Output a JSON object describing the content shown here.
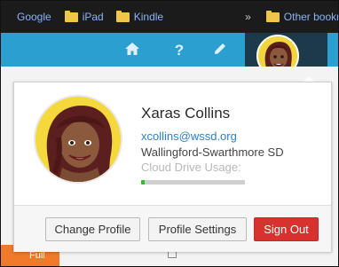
{
  "bookmarks": {
    "items": [
      {
        "label": "Google",
        "icon": "none"
      },
      {
        "label": "iPad",
        "icon": "folder-icon"
      },
      {
        "label": "Kindle",
        "icon": "folder-icon"
      }
    ],
    "overflow": "»",
    "other_label": "Other bookmarks"
  },
  "toolbar": {
    "icons": [
      "home-icon",
      "help-icon",
      "pencil-icon"
    ],
    "help_glyph": "?",
    "caret_glyph": "❯"
  },
  "profile": {
    "name": "Xaras Collins",
    "email": "xcollins@wssd.org",
    "district": "Wallingford-Swarthmore SD",
    "usage_label": "Cloud Drive Usage:",
    "usage_fraction": 0.03
  },
  "buttons": {
    "change_profile": "Change Profile",
    "profile_settings": "Profile Settings",
    "sign_out": "Sign Out"
  },
  "background": {
    "badge_label": "Full"
  },
  "colors": {
    "toolbar": "#2a9fd0",
    "sign_out": "#d8322f",
    "usage_fill": "#2ec02e",
    "link": "#2f7fc0"
  }
}
